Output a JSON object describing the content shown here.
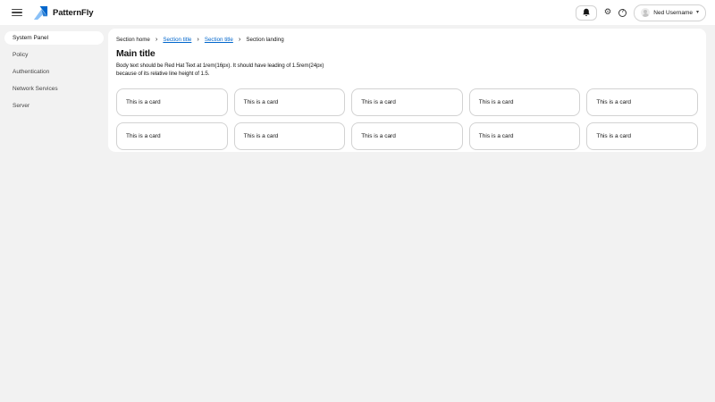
{
  "header": {
    "brand": "PatternFly",
    "user": {
      "name": "Ned Username"
    },
    "icons": {
      "menu": "bars-icon",
      "notifications": "bell-icon",
      "settings": "gear-icon",
      "help": "question-circle-icon",
      "user_caret": "caret-down-icon"
    },
    "help_glyph": "?",
    "gear_glyph": "⚙",
    "caret_glyph": "▾"
  },
  "sidebar": {
    "items": [
      {
        "label": "System Panel",
        "active": true
      },
      {
        "label": "Policy",
        "active": false
      },
      {
        "label": "Authentication",
        "active": false
      },
      {
        "label": "Network Services",
        "active": false
      },
      {
        "label": "Server",
        "active": false
      }
    ]
  },
  "breadcrumb": {
    "separator": "›",
    "items": [
      {
        "label": "Section home",
        "link": false
      },
      {
        "label": "Section title",
        "link": true
      },
      {
        "label": "Section title",
        "link": true
      },
      {
        "label": "Section landing",
        "link": false
      }
    ]
  },
  "main": {
    "title": "Main title",
    "body": "Body text should be Red Hat Text at 1rem(16px). It should have leading of 1.5rem(24px) because of its relative line height of 1.5.",
    "cards": [
      "This is a card",
      "This is a card",
      "This is a card",
      "This is a card",
      "This is a card",
      "This is a card",
      "This is a card",
      "This is a card",
      "This is a card",
      "This is a card"
    ]
  },
  "colors": {
    "page_background": "#f2f2f2",
    "surface": "#ffffff",
    "border": "#d2d2d2",
    "text_primary": "#151515",
    "text_secondary": "#454545",
    "link": "#0066cc",
    "brand_blue_dark": "#0066cc",
    "brand_blue_light": "#8bc1f7"
  }
}
